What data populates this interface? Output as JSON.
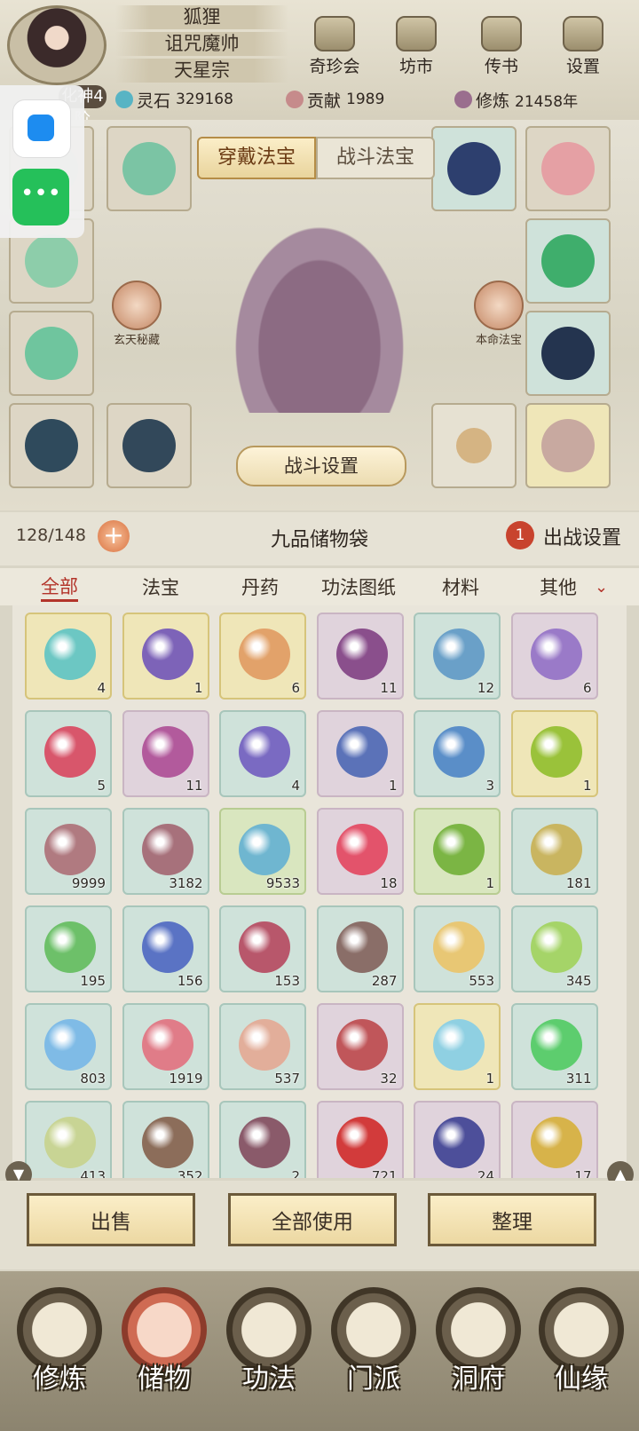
{
  "player": {
    "name": "狐狸",
    "title": "诅咒魔帅",
    "sect": "天星宗",
    "realm": "化神4阶"
  },
  "top_menu": [
    {
      "label": "奇珍会",
      "icon": "treasure-hall-icon"
    },
    {
      "label": "坊市",
      "icon": "market-icon"
    },
    {
      "label": "传书",
      "icon": "letter-scroll-icon"
    },
    {
      "label": "设置",
      "icon": "gear-icon"
    }
  ],
  "resources": {
    "spirit_stone_label": "灵石",
    "spirit_stone": "329168",
    "contribution_label": "贡献",
    "contribution": "1989",
    "cultivation_label": "修炼",
    "cultivation": "21458年"
  },
  "equip": {
    "tab_wear": "穿戴法宝",
    "tab_battle": "战斗法宝",
    "left_secret": "玄天秘藏",
    "right_natal": "本命法宝",
    "battle_settings": "战斗设置"
  },
  "bag": {
    "capacity": "128/148",
    "title": "九品储物袋",
    "deploy_badge": "1",
    "deploy_label": "出战设置"
  },
  "categories": [
    "全部",
    "法宝",
    "丹药",
    "功法图纸",
    "材料",
    "其他"
  ],
  "items": [
    {
      "count": "4",
      "bg": "yellow",
      "color": "#6cc7c3"
    },
    {
      "count": "1",
      "bg": "yellow",
      "color": "#7d63b8"
    },
    {
      "count": "6",
      "bg": "yellow",
      "color": "#e2a26a"
    },
    {
      "count": "11",
      "bg": "purple",
      "color": "#8a4f8c"
    },
    {
      "count": "12",
      "bg": "teal",
      "color": "#6aa0c8"
    },
    {
      "count": "6",
      "bg": "purple",
      "color": "#9a7ac8"
    },
    {
      "count": "5",
      "bg": "teal",
      "color": "#d8566b"
    },
    {
      "count": "11",
      "bg": "purple",
      "color": "#b25a9c"
    },
    {
      "count": "4",
      "bg": "teal",
      "color": "#7a6ac2"
    },
    {
      "count": "1",
      "bg": "purple",
      "color": "#5b72b8"
    },
    {
      "count": "3",
      "bg": "teal",
      "color": "#5a8ec8"
    },
    {
      "count": "1",
      "bg": "yellow",
      "color": "#9ac23a"
    },
    {
      "count": "9999",
      "bg": "teal",
      "color": "#b07a80"
    },
    {
      "count": "3182",
      "bg": "teal",
      "color": "#a7717b"
    },
    {
      "count": "9533",
      "bg": "green",
      "color": "#6fb6d0"
    },
    {
      "count": "18",
      "bg": "purple",
      "color": "#e3536b"
    },
    {
      "count": "1",
      "bg": "green",
      "color": "#7bb544"
    },
    {
      "count": "181",
      "bg": "teal",
      "color": "#c9b560"
    },
    {
      "count": "195",
      "bg": "teal",
      "color": "#6dc069"
    },
    {
      "count": "156",
      "bg": "teal",
      "color": "#5a73c4"
    },
    {
      "count": "153",
      "bg": "teal",
      "color": "#b8576b"
    },
    {
      "count": "287",
      "bg": "teal",
      "color": "#8a6e68"
    },
    {
      "count": "553",
      "bg": "teal",
      "color": "#e8c774"
    },
    {
      "count": "345",
      "bg": "teal",
      "color": "#a5d468"
    },
    {
      "count": "803",
      "bg": "teal",
      "color": "#7fbbe6"
    },
    {
      "count": "1919",
      "bg": "teal",
      "color": "#e07c88"
    },
    {
      "count": "537",
      "bg": "teal",
      "color": "#e2ae9a"
    },
    {
      "count": "32",
      "bg": "purple",
      "color": "#c0565a"
    },
    {
      "count": "1",
      "bg": "yellow",
      "color": "#8fd0e2"
    },
    {
      "count": "311",
      "bg": "teal",
      "color": "#5dcd6e"
    },
    {
      "count": "413",
      "bg": "teal",
      "color": "#c8d494"
    },
    {
      "count": "352",
      "bg": "teal",
      "color": "#8c6d5a"
    },
    {
      "count": "2",
      "bg": "teal",
      "color": "#8a5a6a"
    },
    {
      "count": "721",
      "bg": "purple",
      "color": "#d23b3b"
    },
    {
      "count": "24",
      "bg": "purple",
      "color": "#4d4f9a"
    },
    {
      "count": "17",
      "bg": "purple",
      "color": "#d7b34a"
    }
  ],
  "actions": {
    "sell": "出售",
    "use_all": "全部使用",
    "sort": "整理"
  },
  "nav": [
    {
      "label": "修炼",
      "icon": "cultivate-icon"
    },
    {
      "label": "储物",
      "icon": "storage-bag-icon"
    },
    {
      "label": "功法",
      "icon": "scroll-icon"
    },
    {
      "label": "门派",
      "icon": "sect-gate-icon"
    },
    {
      "label": "洞府",
      "icon": "cave-icon"
    },
    {
      "label": "仙缘",
      "icon": "fate-icon"
    }
  ]
}
